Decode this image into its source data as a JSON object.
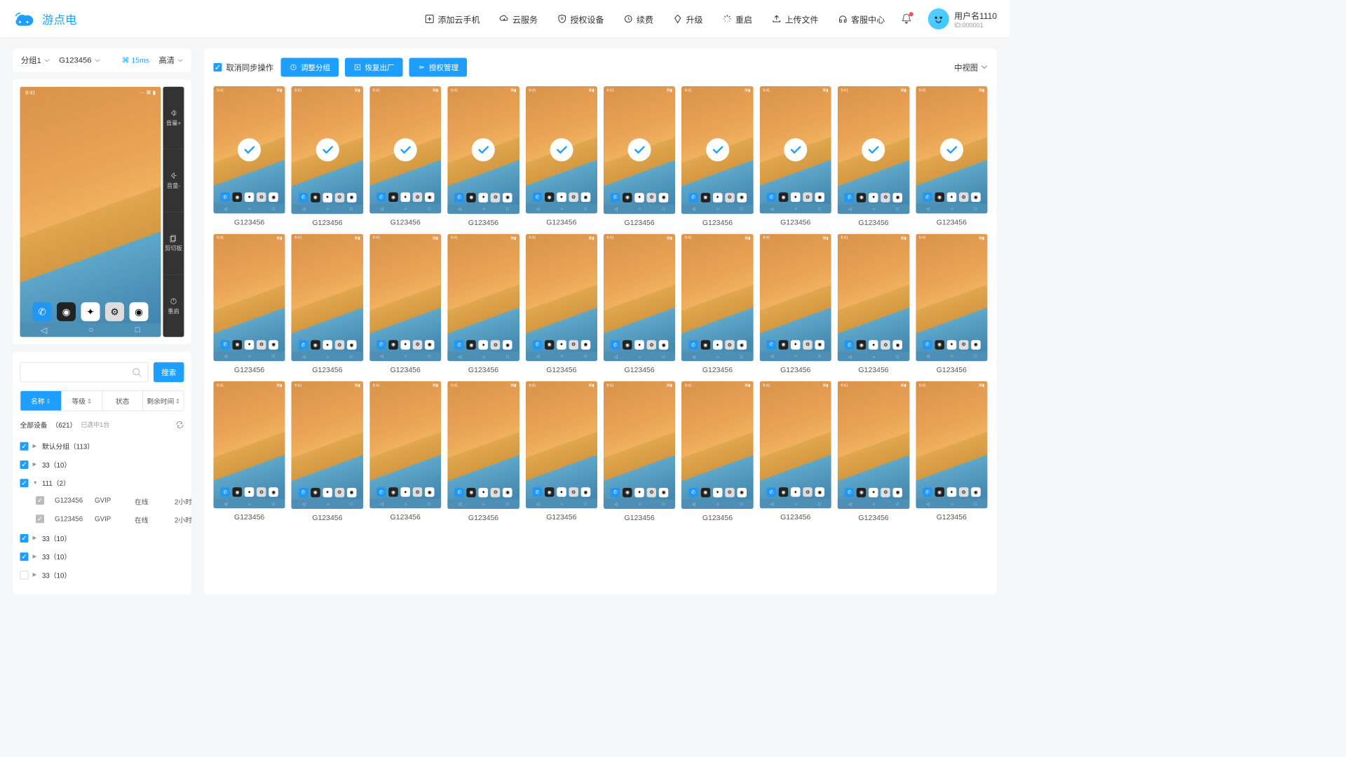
{
  "brand": "游点电",
  "nav": [
    {
      "icon": "plus-box",
      "label": "添加云手机"
    },
    {
      "icon": "cloud",
      "label": "云服务"
    },
    {
      "icon": "shield",
      "label": "授权设备"
    },
    {
      "icon": "refresh",
      "label": "续费"
    },
    {
      "icon": "diamond",
      "label": "升级"
    },
    {
      "icon": "loading",
      "label": "重启"
    },
    {
      "icon": "upload",
      "label": "上传文件"
    },
    {
      "icon": "headset",
      "label": "客服中心"
    }
  ],
  "user": {
    "name": "用户名1110",
    "id": "ID:000001"
  },
  "side_top": {
    "group": "分组1",
    "device": "G123456",
    "ping": "15ms",
    "quality": "高清"
  },
  "phone_ctrl": [
    "音量+",
    "音量-",
    "剪切板",
    "重启"
  ],
  "phone_status_time": "9:41",
  "search": {
    "placeholder": "",
    "btn": "搜索"
  },
  "filters": [
    "名称",
    "等级",
    "状态",
    "剩余时间"
  ],
  "device_head": {
    "label": "全部设备",
    "count": "（621）",
    "sub": "已选中1台"
  },
  "tree": [
    {
      "type": "group",
      "checked": true,
      "arrow": "right",
      "label": "默认分组",
      "count": "（113）"
    },
    {
      "type": "group",
      "checked": true,
      "arrow": "right",
      "label": "33",
      "count": "（10）"
    },
    {
      "type": "group",
      "checked": true,
      "arrow": "down",
      "label": "111",
      "count": "（2）",
      "children": [
        {
          "id": "G123456",
          "tier": "GVIP",
          "status": "在线",
          "remain": "2小时"
        },
        {
          "id": "G123456",
          "tier": "GVIP",
          "status": "在线",
          "remain": "2小时"
        }
      ]
    },
    {
      "type": "group",
      "checked": true,
      "arrow": "right",
      "label": "33",
      "count": "（10）"
    },
    {
      "type": "group",
      "checked": true,
      "arrow": "right",
      "label": "33",
      "count": "（10）"
    },
    {
      "type": "group",
      "checked": false,
      "arrow": "right",
      "label": "33",
      "count": "（10）"
    }
  ],
  "toolbar": {
    "check": "取消同步操作",
    "btns": [
      "调整分组",
      "恢复出厂",
      "授权管理"
    ],
    "view": "中视图"
  },
  "grid": {
    "rows": 3,
    "cols": 10,
    "label": "G123456",
    "first_row_selected": true
  }
}
